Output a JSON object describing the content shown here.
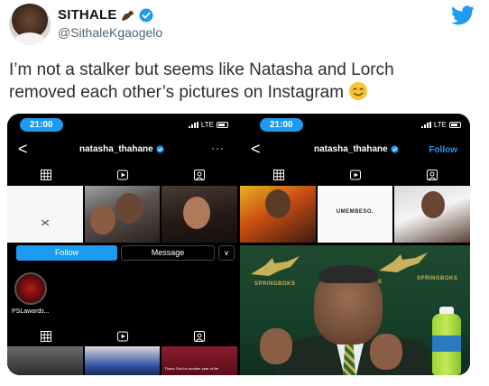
{
  "author": {
    "display_name": "SITHALE",
    "handle": "@SithaleKgaogelo",
    "verified": true,
    "name_emoji": "flexed-biceps-emoji",
    "avatar": "avatar"
  },
  "platform_icon": "twitter-bird-icon",
  "tweet": {
    "text_line1": "I’m not a stalker but seems like Natasha and Lorch",
    "text_line2": "removed each other’s pictures on Instagram",
    "emoji": "smiling-face-with-tear-emoji"
  },
  "media": {
    "top_left": {
      "status_time": "21:00",
      "status_network": "LTE",
      "username": "natasha_thahane",
      "more": "···",
      "back": "<"
    },
    "top_right": {
      "status_time": "21:00",
      "status_network": "LTE",
      "username": "natasha_thahane",
      "follow_link": "Follow",
      "back": "<",
      "post_text": "UMEMBESO."
    },
    "bottom_left": {
      "follow_button": "Follow",
      "message_button": "Message",
      "dropdown": "∨",
      "highlight_label": "PSLawards...",
      "post_caption": "Thank God for another year of life"
    },
    "bottom_right": {
      "brand_text_1": "SPRINGBOKS",
      "brand_text_2": "SPRINGBOKS",
      "brand_text_3": "KS"
    }
  },
  "colors": {
    "accent": "#1d9bf0",
    "text": "#0f1419",
    "secondary": "#536471"
  }
}
